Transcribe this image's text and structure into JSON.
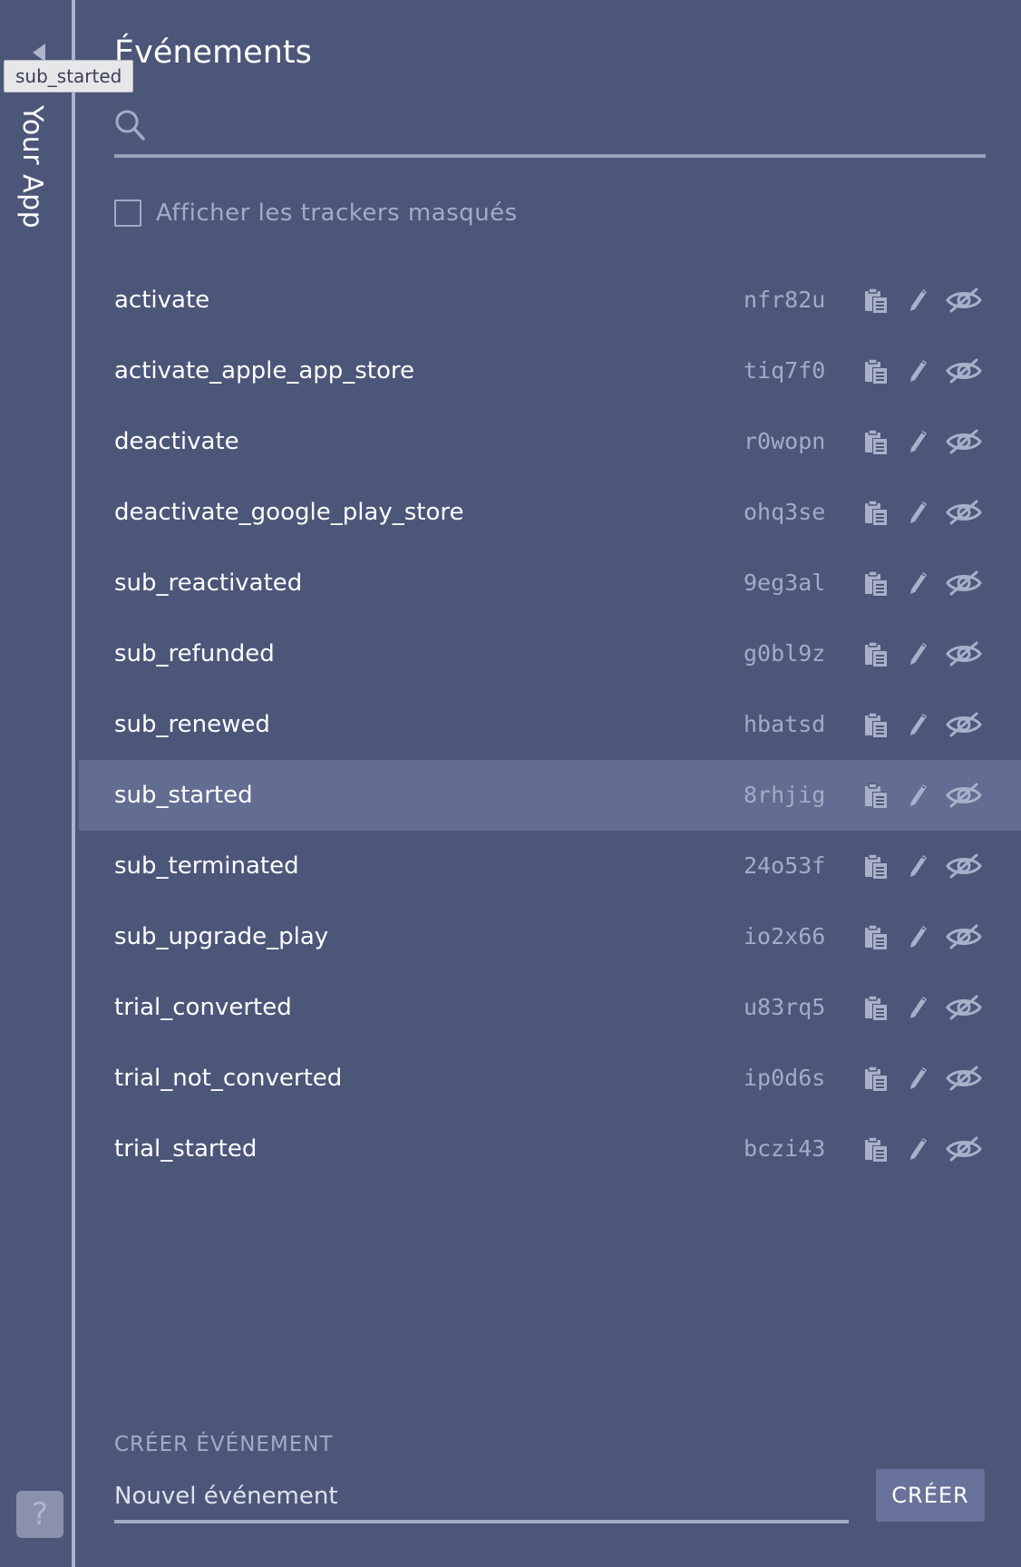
{
  "sidebar": {
    "app_name": "Your App",
    "help_label": "?"
  },
  "tooltip": {
    "text": "sub_started"
  },
  "header": {
    "title": "Événements"
  },
  "search": {
    "placeholder": "",
    "value": ""
  },
  "filters": {
    "show_hidden_label": "Afficher les trackers masqués",
    "show_hidden_checked": false
  },
  "events": [
    {
      "name": "activate",
      "token": "nfr82u"
    },
    {
      "name": "activate_apple_app_store",
      "token": "tiq7f0"
    },
    {
      "name": "deactivate",
      "token": "r0wopn"
    },
    {
      "name": "deactivate_google_play_store",
      "token": "ohq3se"
    },
    {
      "name": "sub_reactivated",
      "token": "9eg3al"
    },
    {
      "name": "sub_refunded",
      "token": "g0bl9z"
    },
    {
      "name": "sub_renewed",
      "token": "hbatsd"
    },
    {
      "name": "sub_started",
      "token": "8rhjig",
      "hovered": true
    },
    {
      "name": "sub_terminated",
      "token": "24o53f"
    },
    {
      "name": "sub_upgrade_play",
      "token": "io2x66"
    },
    {
      "name": "trial_converted",
      "token": "u83rq5"
    },
    {
      "name": "trial_not_converted",
      "token": "ip0d6s"
    },
    {
      "name": "trial_started",
      "token": "bczi43"
    }
  ],
  "row_icons": [
    "copy-icon",
    "pencil-icon",
    "eye-slash-icon"
  ],
  "create": {
    "section_label": "CRÉER ÉVÉNEMENT",
    "input_placeholder": "Nouvel événement",
    "button_label": "CRÉER"
  },
  "colors": {
    "background": "#4c5679",
    "row_highlight": "#636d91",
    "muted_text": "#a4abc5",
    "button": "#69729a"
  }
}
